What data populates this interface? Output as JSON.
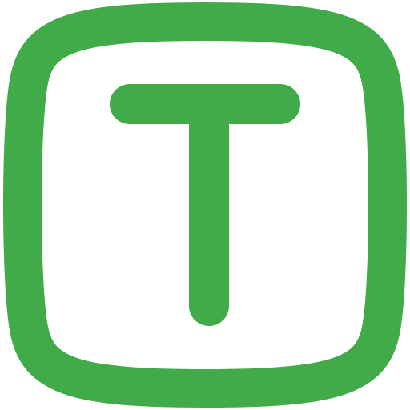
{
  "icon": {
    "name": "letter-t-square-icon",
    "glyph": "T",
    "color": "#42ab49",
    "background": "#ffffff"
  }
}
